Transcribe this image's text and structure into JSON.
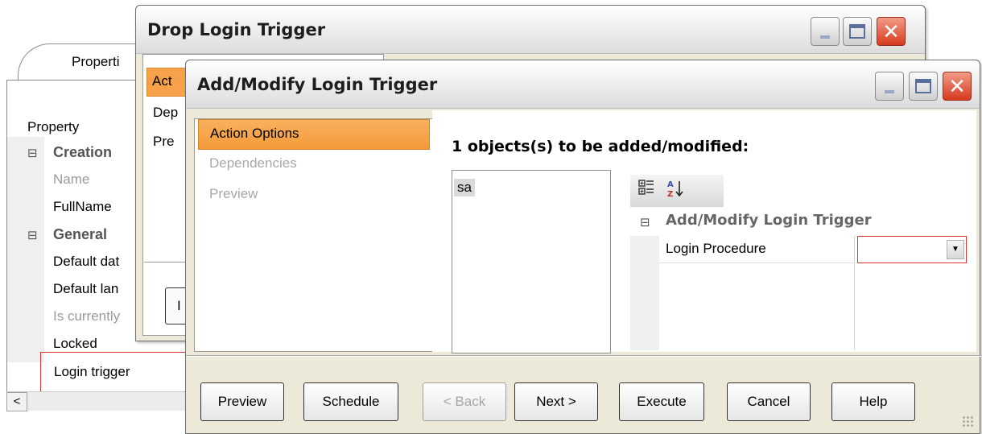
{
  "properties_panel": {
    "tab_label": "Properti",
    "header_label": "Property",
    "rows": [
      {
        "type": "category",
        "label": "Creation",
        "toggle": "⊟"
      },
      {
        "type": "item",
        "label": "Name",
        "state": "disabled"
      },
      {
        "type": "item",
        "label": "FullName",
        "state": "normal"
      },
      {
        "type": "category",
        "label": "General",
        "toggle": "⊟"
      },
      {
        "type": "item",
        "label": "Default dat",
        "state": "normal"
      },
      {
        "type": "item",
        "label": "Default lan",
        "state": "normal"
      },
      {
        "type": "item",
        "label": "Is currently",
        "state": "disabled"
      },
      {
        "type": "item",
        "label": "Locked",
        "state": "normal"
      },
      {
        "type": "item",
        "label": "Login trigger",
        "state": "selected"
      }
    ],
    "scroll_left_glyph": "<"
  },
  "drop_window": {
    "title": "Drop Login Trigger",
    "nav_items": [
      "Act",
      "Dep",
      "Pre"
    ],
    "button_text": "I"
  },
  "main_window": {
    "title": "Add/Modify Login Trigger",
    "nav_items": [
      {
        "label": "Action Options",
        "state": "selected"
      },
      {
        "label": "Dependencies",
        "state": "disabled"
      },
      {
        "label": "Preview",
        "state": "disabled"
      }
    ],
    "section_title": "1 objects(s) to be added/modified:",
    "objects": [
      "sa"
    ],
    "grid": {
      "toolbar": {
        "categorized_icon": "categorized-view-icon",
        "alphabetical_icon": "sort-az-icon"
      },
      "category": "Add/Modify Login Trigger",
      "category_toggle": "⊟",
      "rows": [
        {
          "label": "Login Procedure",
          "value": ""
        }
      ]
    },
    "buttons": {
      "preview": "Preview",
      "schedule": "Schedule",
      "back": "< Back",
      "next": "Next >",
      "execute": "Execute",
      "cancel": "Cancel",
      "help": "Help"
    }
  },
  "window_controls": {
    "minimize": "minimize-icon",
    "maximize": "maximize-icon",
    "close": "close-icon",
    "close_glyph": "✕"
  },
  "colors": {
    "selection_orange": "#f7a24b",
    "error_red": "#e33434",
    "close_red": "#d63a1e"
  }
}
